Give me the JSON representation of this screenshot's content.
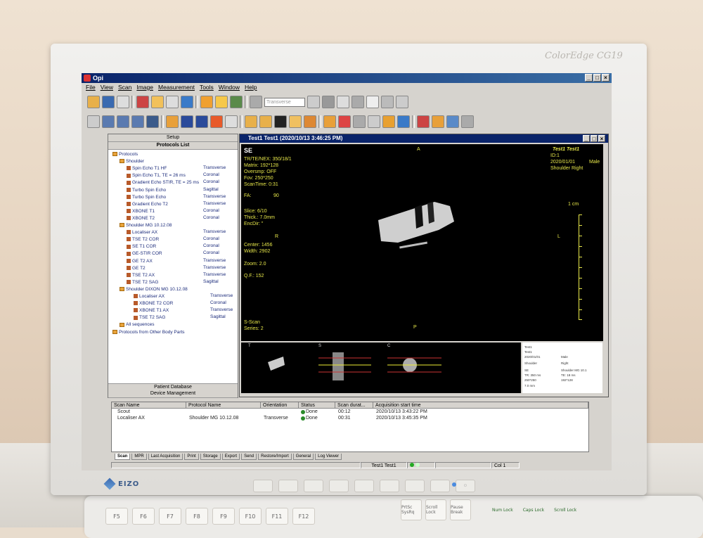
{
  "bezel": {
    "brand": "ColorEdge CG19",
    "maker": "EIZO"
  },
  "app": {
    "title": "Opi"
  },
  "menu": [
    "File",
    "View",
    "Scan",
    "Image",
    "Measurement",
    "Tools",
    "Window",
    "Help"
  ],
  "toolbar": {
    "orientation_combo": "Transverse"
  },
  "left_panel": {
    "tab_setup": "Setup",
    "tab_protocols": "Protocols List",
    "tab_patient_db": "Patient Database",
    "tab_device_mgmt": "Device Management",
    "tree": [
      {
        "label": "Protocols",
        "indent": 0,
        "kind": "folder",
        "orient": ""
      },
      {
        "label": "Shoulder",
        "indent": 1,
        "kind": "folder",
        "orient": ""
      },
      {
        "label": "Spin Echo T1 HF",
        "indent": 2,
        "kind": "seq",
        "orient": "Transverse"
      },
      {
        "label": "Spin Echo T1, TE = 26 ms",
        "indent": 2,
        "kind": "seq",
        "orient": "Coronal"
      },
      {
        "label": "Gradient Echo STIR, TE = 25 ms",
        "indent": 2,
        "kind": "seq",
        "orient": "Coronal"
      },
      {
        "label": "Turbo Spin Echo",
        "indent": 2,
        "kind": "seq",
        "orient": "Sagittal"
      },
      {
        "label": "Turbo Spin Echo",
        "indent": 2,
        "kind": "seq",
        "orient": "Transverse"
      },
      {
        "label": "Gradient Echo T2",
        "indent": 2,
        "kind": "seq",
        "orient": "Transverse"
      },
      {
        "label": "XBONE T1",
        "indent": 2,
        "kind": "seq",
        "orient": "Coronal"
      },
      {
        "label": "XBONE T2",
        "indent": 2,
        "kind": "seq",
        "orient": "Coronal"
      },
      {
        "label": "Shoulder MG 10.12.08",
        "indent": 1,
        "kind": "folder",
        "orient": ""
      },
      {
        "label": "Localiser AX",
        "indent": 2,
        "kind": "seq",
        "orient": "Transverse"
      },
      {
        "label": "TSE T2 COR",
        "indent": 2,
        "kind": "seq",
        "orient": "Coronal"
      },
      {
        "label": "SE T1 COR",
        "indent": 2,
        "kind": "seq",
        "orient": "Coronal"
      },
      {
        "label": "GE-STIR COR",
        "indent": 2,
        "kind": "seq",
        "orient": "Coronal"
      },
      {
        "label": "GE T2 AX",
        "indent": 2,
        "kind": "seq",
        "orient": "Transverse"
      },
      {
        "label": "GE T2",
        "indent": 2,
        "kind": "seq",
        "orient": "Transverse"
      },
      {
        "label": "TSE T2 AX",
        "indent": 2,
        "kind": "seq",
        "orient": "Transverse"
      },
      {
        "label": "TSE T2 SAG",
        "indent": 2,
        "kind": "seq",
        "orient": "Sagittal"
      },
      {
        "label": "Shoulder DIXON MG 10.12.08",
        "indent": 1,
        "kind": "folder",
        "orient": ""
      },
      {
        "label": "Localiser AX",
        "indent": 3,
        "kind": "seq",
        "orient": "Transverse"
      },
      {
        "label": "XBONE T2 COR",
        "indent": 3,
        "kind": "seq",
        "orient": "Coronal"
      },
      {
        "label": "XBONE T1 AX",
        "indent": 3,
        "kind": "seq",
        "orient": "Transverse"
      },
      {
        "label": "TSE T2 SAG",
        "indent": 3,
        "kind": "seq",
        "orient": "Sagittal"
      },
      {
        "label": "All sequences",
        "indent": 1,
        "kind": "folder",
        "orient": ""
      },
      {
        "label": "Protocols from Other Body Parts",
        "indent": 0,
        "kind": "folder",
        "orient": ""
      }
    ]
  },
  "viewer": {
    "title": "Test1 Test1 (2020/10/13 3:46:25 PM)",
    "top_left": {
      "seq": "SE",
      "line1": "TR/TE/NEX: 350/18/1",
      "line2": "Matrix:    192*128",
      "line3": "Oversmp:  OFF",
      "line4": "Fov:       250*250",
      "line5": "ScanTime: 0:31",
      "fa_label": "FA:",
      "fa_value": "90",
      "slice": "Slice: 6/10",
      "thick": "Thick.: 7.0mm",
      "encdir": "EncDir: \"",
      "center": "Center: 1456",
      "width": "Width:  2902",
      "zoom": "Zoom:  2.0",
      "qf": "Q.F.:  152",
      "sscan": "S-Scan",
      "series": "Series:  2"
    },
    "top_right": {
      "name": "Test1 Test1",
      "id": "ID:1",
      "dob": "2020/01/01",
      "sex": "Male",
      "region": "Shoulder Right"
    },
    "markers": {
      "a": "A",
      "p": "P",
      "r": "R",
      "l": "L"
    },
    "scale": "1 cm",
    "thumbs": [
      "T",
      "S",
      "C"
    ],
    "thumb_info": [
      "Test1",
      "Test1",
      "2020/01/01",
      "Male",
      "Shoulder",
      "Right",
      "SE",
      "Shoulder MG 10.1",
      "TR: 350 ms",
      "TE: 18 ms",
      "250*250",
      "192*128",
      "7.0 mm"
    ]
  },
  "scan_list": {
    "headers": [
      "Scan Name",
      "Protocol Name",
      "Orientation",
      "Status",
      "Scan durat...",
      "Acquisition start time"
    ],
    "rows": [
      {
        "name": "Scout",
        "protocol": "",
        "orientation": "",
        "status": "Done",
        "duration": "00:12",
        "start": "2020/10/13 3:43:22 PM"
      },
      {
        "name": "Localiser AX",
        "protocol": "Shoulder MG 10.12.08",
        "orientation": "Transverse",
        "status": "Done",
        "duration": "00:31",
        "start": "2020/10/13 3:45:35 PM"
      }
    ]
  },
  "tabs": [
    "Scan",
    "MPR",
    "Last Acquisition",
    "Print",
    "Storage",
    "Export",
    "Send",
    "Restore/Import",
    "General",
    "Log Viewer"
  ],
  "status": {
    "patient": "Test1 Test1",
    "col": "Col 1"
  },
  "keyboard": {
    "keys": [
      "F5",
      "F6",
      "F7",
      "F8",
      "F9",
      "F10",
      "F11",
      "F12"
    ],
    "special": [
      "PrtSc SysRq",
      "Scroll Lock",
      "Pause Break"
    ],
    "leds": [
      "Num Lock",
      "Caps Lock",
      "Scroll Lock"
    ]
  }
}
